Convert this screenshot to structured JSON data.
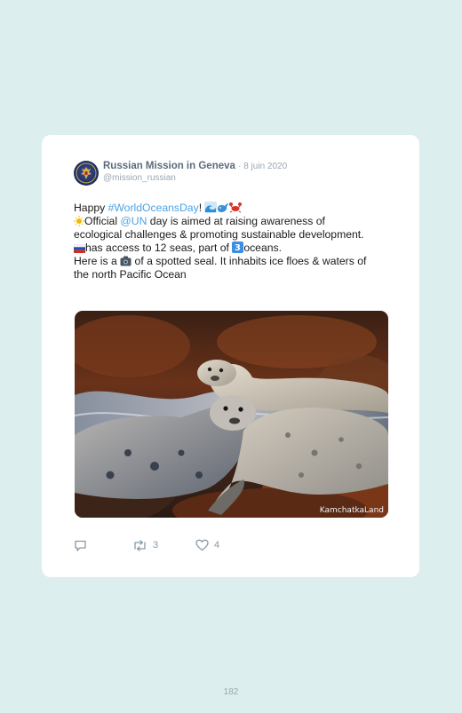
{
  "tweet": {
    "author_name": "Russian Mission in Geneva",
    "date": "· 8 juin 2020",
    "handle": "@mission_russian",
    "line1_prefix": "Happy ",
    "hashtag": "#WorldOceansDay",
    "line1_excl": "!",
    "line2_a": "Official ",
    "mention": "@UN",
    "line2_b": " day is aimed at raising awareness of ecological challenges & promoting sustainable development.",
    "line3_a": "has access to 12 seas, part of ",
    "line3_num": "3",
    "line3_b": "oceans.",
    "line4_a": "Here is a ",
    "line4_b": " of a spotted seal. It inhabits ice floes & waters of the north Pacific Ocean",
    "photo_watermark": "KamchatkaLand",
    "emojis": [
      "wave-icon",
      "whale-icon",
      "crab-icon",
      "sun-icon",
      "russia-flag-icon",
      "keycap-3-icon",
      "camera-icon"
    ]
  },
  "actions": {
    "reply_count": "",
    "retweet_count": "3",
    "like_count": "4"
  },
  "colors": {
    "background": "#dceeee",
    "card": "#ffffff",
    "link": "#4ba3e3",
    "muted": "#9aa6b2",
    "name": "#5b6b7d"
  },
  "page_number": "182"
}
